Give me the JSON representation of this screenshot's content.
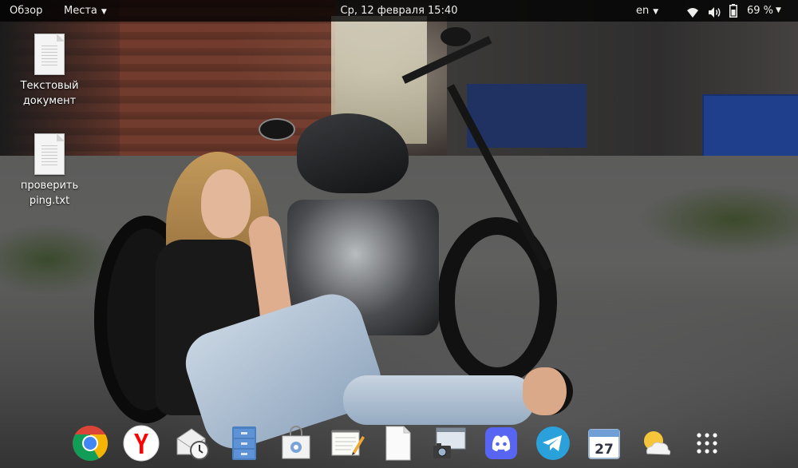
{
  "topbar": {
    "activities": "Обзор",
    "places": "Места",
    "clock": "Ср, 12 февраля  15:40",
    "language": "en",
    "battery": "69 %",
    "icons": [
      "wifi-icon",
      "volume-icon",
      "battery-icon",
      "system-menu-arrow-icon"
    ]
  },
  "desktop": {
    "icons": [
      {
        "label": "Текстовый документ",
        "line1": "Текстовый",
        "line2": "документ",
        "icon": "text-document-icon"
      },
      {
        "label": "проверить ping.txt",
        "line1": "проверить",
        "line2": "ping.txt",
        "icon": "text-file-icon"
      }
    ]
  },
  "dock": {
    "apps": [
      {
        "name": "chrome",
        "icon": "chrome-icon"
      },
      {
        "name": "yandex-browser",
        "icon": "yandex-icon"
      },
      {
        "name": "mail",
        "icon": "mail-clock-icon"
      },
      {
        "name": "files",
        "icon": "file-cabinet-icon"
      },
      {
        "name": "software-store",
        "icon": "shopping-bag-icon"
      },
      {
        "name": "notes",
        "icon": "notepad-pencil-icon"
      },
      {
        "name": "text-editor",
        "icon": "blank-document-icon"
      },
      {
        "name": "screenshot",
        "icon": "screenshot-camera-icon"
      },
      {
        "name": "discord",
        "icon": "discord-icon"
      },
      {
        "name": "telegram",
        "icon": "telegram-icon"
      },
      {
        "name": "calendar",
        "icon": "calendar-icon",
        "day": "27"
      },
      {
        "name": "weather",
        "icon": "weather-icon"
      },
      {
        "name": "show-applications",
        "icon": "app-grid-icon"
      }
    ]
  },
  "colors": {
    "topbar_bg": "#000000",
    "topbar_text": "#eeeeec",
    "chrome_red": "#db4437",
    "chrome_green": "#0f9d58",
    "chrome_yellow": "#f4b400",
    "chrome_blue": "#4285f4",
    "discord": "#5865f2",
    "telegram": "#2aa1da"
  }
}
